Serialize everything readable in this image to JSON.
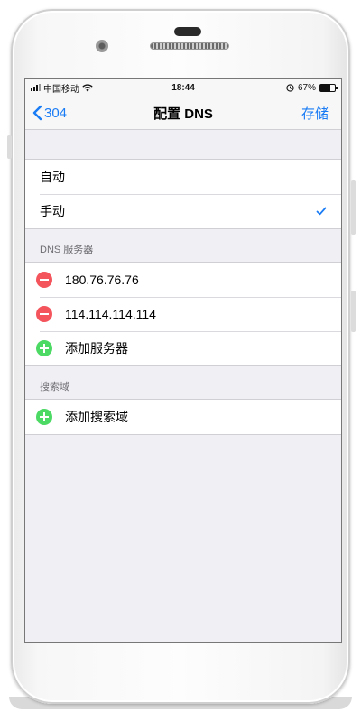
{
  "status_bar": {
    "carrier": "中国移动",
    "time": "18:44",
    "battery_percent_text": "67%",
    "battery_level": 0.67
  },
  "nav": {
    "back_label": "304",
    "title": "配置 DNS",
    "save_label": "存储"
  },
  "mode_options": [
    {
      "label": "自动",
      "selected": false
    },
    {
      "label": "手动",
      "selected": true
    }
  ],
  "dns_section": {
    "header": "DNS 服务器",
    "servers": [
      "180.76.76.76",
      "114.114.114.114"
    ],
    "add_label": "添加服务器"
  },
  "search_section": {
    "header": "搜索域",
    "add_label": "添加搜索域"
  },
  "colors": {
    "accent": "#1a7cf5",
    "delete": "#f4545c",
    "add": "#4cd964",
    "background": "#efeff4"
  },
  "icons": {
    "wifi": "wifi-icon",
    "alarm": "alarm-icon",
    "back": "chevron-left-icon",
    "check": "checkmark-icon",
    "delete": "minus-circle-icon",
    "add": "plus-circle-icon"
  }
}
